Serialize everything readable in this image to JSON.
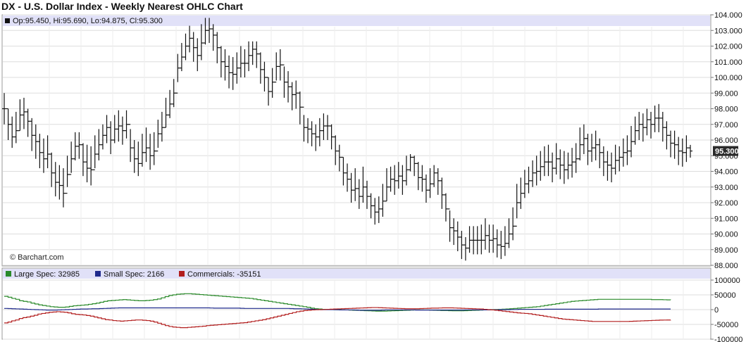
{
  "page": {
    "title": "DX - U.S. Dollar Index - Weekly Nearest OHLC Chart"
  },
  "chart_data": [
    {
      "type": "ohlc",
      "ohlc_label": "Op:95.450, Hi:95.690, Lo:94.875, Cl:95.300",
      "watermark": "© Barchart.com",
      "last_price_label": "95.300",
      "last_price": 95.3,
      "ylim": [
        88,
        104
      ],
      "yticks": [
        88,
        89,
        90,
        91,
        92,
        93,
        94,
        95,
        96,
        97,
        98,
        99,
        100,
        101,
        102,
        103,
        104
      ],
      "ytick_labels": [
        "88.000",
        "89.000",
        "90.000",
        "91.000",
        "92.000",
        "93.000",
        "94.000",
        "95.000",
        "96.000",
        "97.000",
        "98.000",
        "99.000",
        "100.000",
        "101.000",
        "102.000",
        "103.000",
        "104.000"
      ],
      "grid": true,
      "colors": {
        "bar": "#111111",
        "header_band": "#e1e1f8",
        "grid": "#dddddd"
      },
      "closes": [
        98.0,
        97.0,
        96.2,
        96.6,
        97.6,
        97.8,
        97.2,
        96.3,
        95.9,
        95.2,
        94.8,
        95.1,
        93.9,
        93.3,
        93.1,
        92.6,
        93.8,
        94.8,
        95.6,
        95.7,
        94.6,
        94.2,
        94.1,
        95.1,
        95.7,
        96.3,
        96.8,
        96.0,
        96.7,
        96.9,
        96.6,
        97.0,
        95.5,
        94.8,
        94.5,
        95.2,
        95.5,
        95.0,
        95.3,
        96.4,
        96.8,
        97.6,
        98.3,
        99.0,
        100.6,
        101.3,
        102.0,
        102.5,
        101.9,
        101.4,
        102.2,
        103.0,
        103.1,
        102.7,
        101.9,
        101.0,
        100.7,
        100.3,
        100.2,
        100.6,
        100.9,
        100.9,
        101.4,
        101.8,
        101.5,
        100.5,
        100.0,
        99.1,
        99.7,
        100.7,
        100.8,
        99.7,
        99.4,
        98.9,
        99.0,
        98.1,
        96.8,
        96.7,
        96.4,
        96.2,
        96.6,
        96.9,
        96.9,
        96.2,
        95.3,
        94.9,
        93.9,
        93.5,
        92.8,
        92.9,
        92.4,
        93.0,
        92.4,
        91.8,
        91.4,
        91.6,
        92.1,
        93.0,
        93.5,
        93.4,
        93.7,
        93.4,
        94.1,
        94.9,
        94.5,
        93.6,
        93.5,
        92.8,
        93.2,
        93.9,
        93.4,
        92.5,
        91.6,
        90.4,
        90.2,
        89.8,
        89.3,
        89.1,
        89.6,
        89.6,
        89.6,
        89.6,
        89.9,
        89.6,
        89.7,
        89.3,
        89.2,
        89.4,
        90.0,
        90.5,
        92.0,
        92.6,
        93.2,
        93.4,
        93.9,
        94.0,
        94.3,
        94.6,
        94.6,
        94.2,
        94.8,
        94.4,
        94.1,
        94.4,
        94.6,
        94.8,
        95.7,
        96.1,
        95.3,
        95.5,
        95.7,
        95.2,
        94.6,
        94.4,
        94.2,
        94.7,
        94.9,
        95.2,
        95.3,
        95.9,
        96.6,
        97.0,
        96.8,
        97.3,
        97.0,
        97.4,
        97.4,
        96.8,
        96.3,
        95.8,
        95.7,
        95.3,
        95.2,
        95.5,
        95.3
      ],
      "highs": [
        99.0,
        98.0,
        97.5,
        97.8,
        98.6,
        98.7,
        98.0,
        97.4,
        97.0,
        96.4,
        96.1,
        96.3,
        95.2,
        94.6,
        94.4,
        94.2,
        95.0,
        95.9,
        96.5,
        96.5,
        95.8,
        95.7,
        95.6,
        96.3,
        96.7,
        97.0,
        97.6,
        97.2,
        97.6,
        97.9,
        97.5,
        97.9,
        96.7,
        96.0,
        95.9,
        96.4,
        96.8,
        96.4,
        96.5,
        97.3,
        97.8,
        98.7,
        99.2,
        99.9,
        101.5,
        102.2,
        102.8,
        103.3,
        102.9,
        102.5,
        103.4,
        103.8,
        103.8,
        103.4,
        102.9,
        102.0,
        101.8,
        101.4,
        101.3,
        101.6,
        102.0,
        101.8,
        102.3,
        102.3,
        102.3,
        101.6,
        101.0,
        100.0,
        100.6,
        101.6,
        101.8,
        100.7,
        100.4,
        99.7,
        99.8,
        99.1,
        97.6,
        97.4,
        97.2,
        97.0,
        97.4,
        97.7,
        97.6,
        97.0,
        96.3,
        95.7,
        94.9,
        94.5,
        93.9,
        94.2,
        93.5,
        94.3,
        93.4,
        92.6,
        92.3,
        92.4,
        93.2,
        94.2,
        94.3,
        94.4,
        94.6,
        94.4,
        95.0,
        95.1,
        95.0,
        94.6,
        94.4,
        93.8,
        94.2,
        94.4,
        94.2,
        93.6,
        92.6,
        91.5,
        91.0,
        90.8,
        90.2,
        89.8,
        90.5,
        90.5,
        90.5,
        90.6,
        91.0,
        90.6,
        90.6,
        90.3,
        90.2,
        90.5,
        91.0,
        91.7,
        93.2,
        93.6,
        94.1,
        94.3,
        94.7,
        95.0,
        95.3,
        95.6,
        95.7,
        95.2,
        95.8,
        95.4,
        95.3,
        95.2,
        95.5,
        95.8,
        96.8,
        97.0,
        96.4,
        96.4,
        96.6,
        96.1,
        95.6,
        95.3,
        95.2,
        95.7,
        95.6,
        96.1,
        96.3,
        96.9,
        97.5,
        97.8,
        97.7,
        98.0,
        97.8,
        98.2,
        98.3,
        97.8,
        97.2,
        96.6,
        96.6,
        96.2,
        96.1,
        96.3,
        95.69
      ],
      "lows": [
        97.0,
        96.0,
        95.5,
        95.8,
        96.6,
        96.7,
        96.2,
        95.3,
        94.8,
        94.2,
        93.9,
        94.2,
        93.0,
        92.4,
        92.2,
        91.7,
        93.0,
        93.9,
        94.7,
        94.8,
        93.7,
        93.3,
        93.1,
        94.2,
        94.7,
        95.4,
        95.8,
        95.1,
        95.8,
        95.9,
        95.7,
        96.1,
        94.6,
        93.9,
        93.7,
        94.3,
        94.6,
        94.1,
        94.4,
        95.5,
        95.9,
        96.8,
        97.4,
        98.1,
        99.7,
        100.4,
        101.1,
        101.6,
        101.0,
        100.4,
        101.1,
        102.1,
        102.2,
        101.7,
        100.9,
        100.0,
        99.8,
        99.3,
        99.2,
        99.6,
        100.0,
        100.0,
        100.4,
        100.8,
        100.6,
        99.6,
        99.1,
        98.2,
        98.7,
        99.8,
        99.8,
        98.7,
        98.4,
        97.9,
        98.0,
        97.0,
        95.9,
        95.8,
        95.6,
        95.3,
        95.6,
        96.0,
        96.0,
        95.4,
        94.4,
        94.0,
        93.1,
        92.7,
        92.0,
        92.1,
        91.6,
        92.0,
        91.6,
        91.0,
        90.6,
        90.7,
        91.1,
        92.1,
        92.7,
        92.5,
        92.9,
        92.5,
        93.1,
        94.0,
        93.7,
        92.8,
        92.7,
        92.0,
        92.3,
        93.0,
        92.5,
        91.6,
        90.8,
        89.5,
        89.3,
        88.9,
        88.4,
        88.3,
        88.8,
        88.7,
        88.7,
        88.7,
        89.0,
        88.8,
        88.8,
        88.5,
        88.4,
        88.6,
        89.1,
        89.6,
        91.0,
        91.6,
        92.3,
        92.6,
        93.0,
        93.1,
        93.4,
        93.7,
        93.7,
        93.3,
        93.8,
        93.5,
        93.2,
        93.5,
        93.6,
        93.9,
        94.7,
        95.1,
        94.4,
        94.6,
        94.7,
        94.2,
        93.7,
        93.4,
        93.3,
        93.8,
        94.0,
        94.3,
        94.4,
        94.9,
        95.7,
        96.0,
        95.9,
        96.3,
        96.1,
        96.5,
        96.5,
        95.9,
        95.4,
        94.9,
        94.8,
        94.4,
        94.3,
        94.6,
        94.875
      ]
    },
    {
      "type": "line",
      "ylim": [
        -100000,
        100000
      ],
      "yticks": [
        -100000,
        -50000,
        0,
        50000,
        100000
      ],
      "ytick_labels": [
        "-100000",
        "-50000",
        "0",
        "50000",
        "100000"
      ],
      "grid": true,
      "legend_position": "top-left",
      "series": [
        {
          "name": "Large Spec: 32985",
          "color": "#2a8a2a",
          "values": [
            45000,
            42000,
            38000,
            35000,
            30000,
            28000,
            26000,
            22000,
            19000,
            16000,
            14000,
            12000,
            10000,
            9000,
            8000,
            8000,
            9000,
            11000,
            13000,
            14000,
            15000,
            16000,
            18000,
            20000,
            22000,
            25000,
            28000,
            30000,
            31000,
            32000,
            33000,
            34000,
            33000,
            32000,
            31000,
            30000,
            30000,
            31000,
            32000,
            34000,
            36000,
            40000,
            44000,
            48000,
            50000,
            52000,
            53000,
            54000,
            54000,
            53000,
            52000,
            51000,
            50000,
            49000,
            48000,
            47000,
            46000,
            45000,
            44000,
            43000,
            42000,
            41000,
            40000,
            39000,
            38000,
            36000,
            34000,
            32000,
            30000,
            28000,
            26000,
            24000,
            22000,
            20000,
            18000,
            16000,
            14000,
            12000,
            10000,
            8000,
            5000,
            3000,
            2000,
            1000,
            1000,
            500,
            0,
            -500,
            -1000,
            -1000,
            -1500,
            -2000,
            -2500,
            -3000,
            -3500,
            -4000,
            -4500,
            -5000,
            -5000,
            -5000,
            -4500,
            -4000,
            -3500,
            -3000,
            -2500,
            -2000,
            -1500,
            -1000,
            -1000,
            -1000,
            -1000,
            -1500,
            -2000,
            -2500,
            -3000,
            -3000,
            -3500,
            -4000,
            -4000,
            -4000,
            -3500,
            -3000,
            -2500,
            -2000,
            -1500,
            -1000,
            -500,
            0,
            500,
            1000,
            1500,
            2000,
            3000,
            4000,
            5000,
            6000,
            7000,
            8000,
            9000,
            10000,
            12000,
            14000,
            16000,
            18000,
            20000,
            22000,
            24000,
            26000,
            28000,
            29000,
            30000,
            31000,
            32000,
            33000,
            34000,
            35000,
            35000,
            35000,
            35000,
            35000,
            35000,
            35000,
            35000,
            35000,
            35000,
            35000,
            35000,
            35000,
            35000,
            34000,
            34000,
            34000,
            33500,
            33000,
            32985
          ]
        },
        {
          "name": "Small Spec: 2166",
          "color": "#1f2a8c",
          "values": [
            4000,
            3500,
            3000,
            2500,
            2000,
            1500,
            1000,
            500,
            0,
            -500,
            -1000,
            -1500,
            -1500,
            -1500,
            -1000,
            -500,
            0,
            500,
            1000,
            1500,
            2000,
            2000,
            2500,
            3000,
            3000,
            3500,
            4000,
            4500,
            5000,
            5500,
            6000,
            6000,
            6000,
            6000,
            6000,
            6000,
            6000,
            6000,
            6000,
            6000,
            6000,
            6000,
            6000,
            6000,
            6000,
            6000,
            6000,
            6000,
            6000,
            6000,
            6000,
            6000,
            6000,
            6000,
            5500,
            5000,
            5000,
            5000,
            5000,
            5000,
            5000,
            5000,
            4500,
            4000,
            4000,
            4000,
            4000,
            4000,
            4000,
            4000,
            4000,
            4000,
            4000,
            4000,
            4000,
            3500,
            3000,
            3000,
            2500,
            2000,
            1500,
            1000,
            500,
            0,
            0,
            0,
            0,
            -500,
            -1000,
            -1000,
            -1000,
            -1000,
            -1500,
            -2000,
            -2000,
            -2000,
            -2000,
            -2000,
            -2000,
            -1500,
            -1000,
            -1000,
            -1000,
            -1000,
            -1000,
            -1000,
            -1000,
            -1000,
            -1500,
            -1500,
            -1500,
            -1500,
            -1500,
            -1500,
            -1500,
            -1500,
            -1500,
            -1500,
            -1500,
            -1500,
            -1500,
            -1000,
            -1000,
            -1000,
            -1000,
            -1000,
            -1000,
            -1000,
            -500,
            -500,
            0,
            0,
            0,
            500,
            500,
            1000,
            1000,
            1000,
            1000,
            1000,
            1000,
            1000,
            1500,
            1500,
            1500,
            1500,
            1500,
            1500,
            1500,
            1500,
            1500,
            1500,
            1500,
            1500,
            1500,
            1500,
            2000,
            2000,
            2000,
            2000,
            2000,
            2000,
            2000,
            2000,
            2000,
            2000,
            2000,
            2000,
            2000,
            2000,
            2000,
            2000,
            2166,
            2166,
            2166,
            2166
          ]
        },
        {
          "name": "Commercials: -35151",
          "color": "#b21e1e",
          "values": [
            -45000,
            -42000,
            -38000,
            -35000,
            -30000,
            -27000,
            -25000,
            -22000,
            -19000,
            -15000,
            -13000,
            -11000,
            -9000,
            -8000,
            -7000,
            -8000,
            -9000,
            -11000,
            -14000,
            -16000,
            -17000,
            -18000,
            -20000,
            -22000,
            -25000,
            -28000,
            -31000,
            -34000,
            -35000,
            -37000,
            -38000,
            -39000,
            -38000,
            -37000,
            -36000,
            -35000,
            -35000,
            -36000,
            -37000,
            -39000,
            -42000,
            -46000,
            -50000,
            -54000,
            -57000,
            -59000,
            -60000,
            -61000,
            -61000,
            -60000,
            -59000,
            -58000,
            -57000,
            -56000,
            -54000,
            -53000,
            -52000,
            -51000,
            -50000,
            -49000,
            -48000,
            -47000,
            -46000,
            -45000,
            -44000,
            -42000,
            -40000,
            -38000,
            -36000,
            -34000,
            -31000,
            -28000,
            -25000,
            -22000,
            -19000,
            -16000,
            -13000,
            -10000,
            -7000,
            -5000,
            -3000,
            -2000,
            -1000,
            -500,
            0,
            500,
            1000,
            1500,
            2000,
            2500,
            3000,
            3500,
            4000,
            4500,
            5000,
            5500,
            6000,
            6500,
            7000,
            7000,
            6500,
            6000,
            5500,
            5000,
            4500,
            4000,
            3500,
            3000,
            3000,
            3000,
            3000,
            3500,
            4000,
            4500,
            5000,
            5000,
            5500,
            6000,
            6000,
            6000,
            5500,
            5000,
            4500,
            4000,
            3500,
            3000,
            2500,
            2000,
            1000,
            0,
            -1000,
            -2000,
            -3500,
            -5000,
            -6500,
            -8000,
            -9500,
            -11000,
            -12000,
            -13000,
            -14000,
            -16000,
            -18000,
            -20000,
            -22000,
            -24000,
            -26000,
            -28000,
            -30000,
            -32000,
            -33000,
            -34000,
            -35000,
            -36000,
            -37000,
            -38000,
            -39000,
            -40000,
            -40000,
            -40000,
            -40000,
            -40000,
            -40000,
            -40000,
            -40000,
            -40000,
            -40000,
            -39500,
            -39000,
            -38500,
            -38000,
            -37500,
            -37000,
            -36500,
            -36000,
            -35500,
            -35300,
            -35200,
            -35151
          ]
        }
      ]
    }
  ]
}
